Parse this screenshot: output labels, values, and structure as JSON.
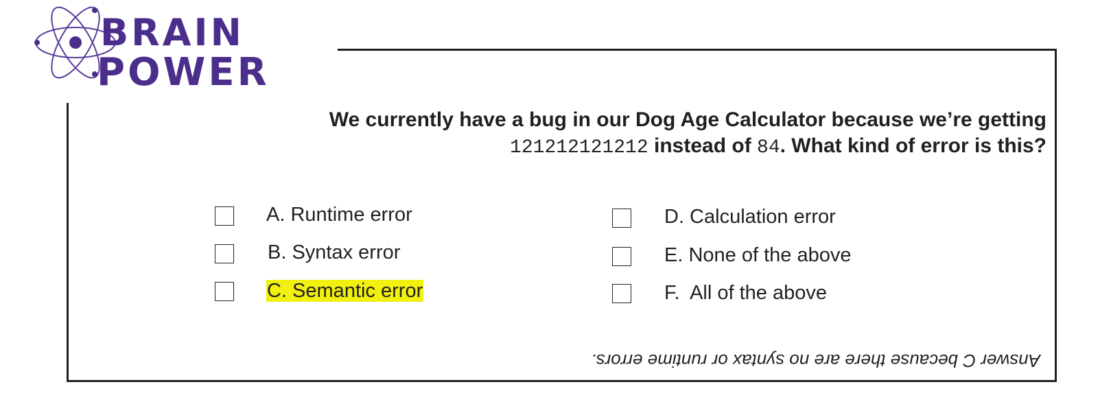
{
  "logo": {
    "line1": "BRAIN",
    "line2": "POWER",
    "icon": "atom-icon",
    "color": "#4b2e8c"
  },
  "question": {
    "line1": "We currently have a bug in our Dog Age Calculator because we’re getting",
    "code1": "121212121212",
    "mid": " instead of ",
    "code2": "84",
    "end": ". What kind of error is this?"
  },
  "options": {
    "a": "A. Runtime error",
    "b": "B. Syntax error",
    "c": "C. Semantic error",
    "d": "D. Calculation error",
    "e": "E. None of the above",
    "f": "F.  All of the above"
  },
  "highlight_color": "#f2f00f",
  "answer": "Answer C because there are no syntax or runtime errors."
}
